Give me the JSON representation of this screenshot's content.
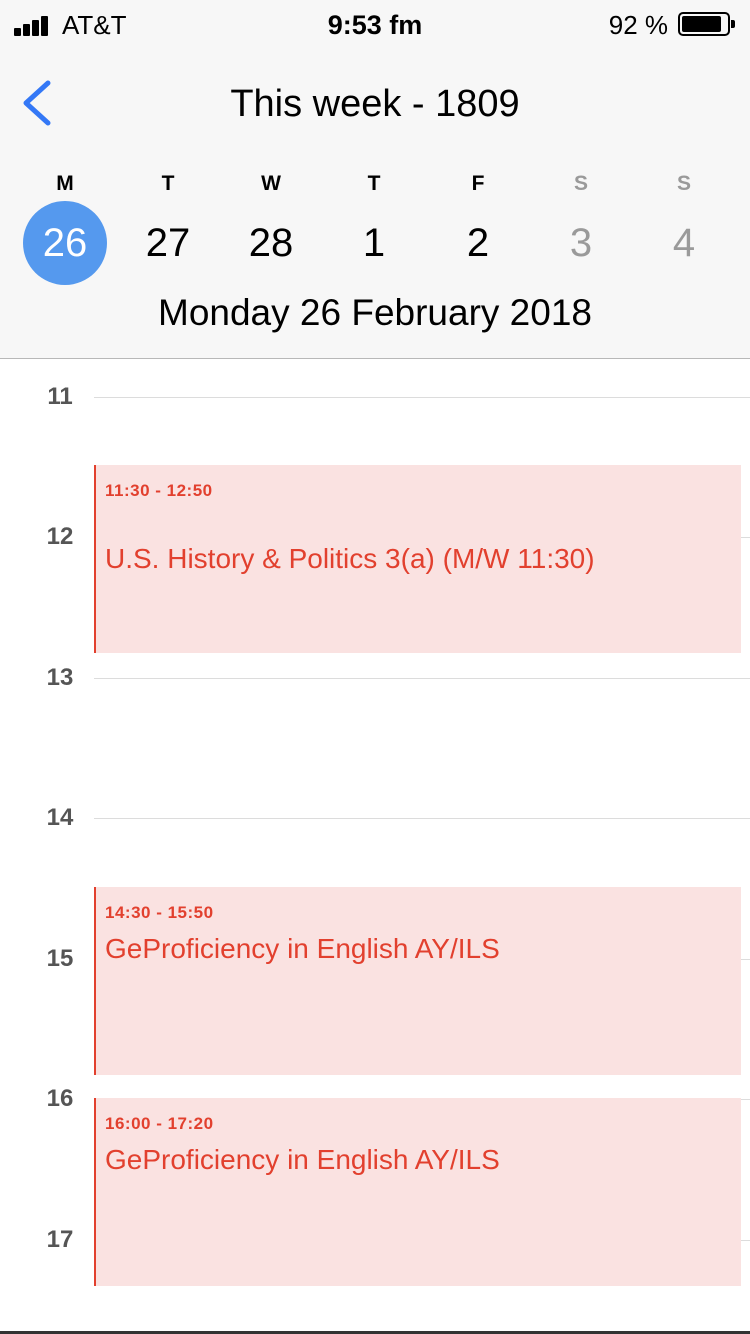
{
  "status_bar": {
    "carrier": "AT&T",
    "time": "9:53 fm",
    "battery_percent": "92 %",
    "battery_level": 0.92
  },
  "nav": {
    "back_icon": "chevron-left-icon",
    "title": "This week - 1809"
  },
  "week": {
    "days": [
      {
        "letter": "M",
        "number": "26",
        "selected": true,
        "weekend": false
      },
      {
        "letter": "T",
        "number": "27",
        "selected": false,
        "weekend": false
      },
      {
        "letter": "W",
        "number": "28",
        "selected": false,
        "weekend": false
      },
      {
        "letter": "T",
        "number": "1",
        "selected": false,
        "weekend": false
      },
      {
        "letter": "F",
        "number": "2",
        "selected": false,
        "weekend": false
      },
      {
        "letter": "S",
        "number": "3",
        "selected": false,
        "weekend": true
      },
      {
        "letter": "S",
        "number": "4",
        "selected": false,
        "weekend": true
      }
    ],
    "selected_date_label": "Monday 26 February 2018"
  },
  "timeline": {
    "hours": [
      "11",
      "12",
      "13",
      "14",
      "15",
      "16",
      "17"
    ],
    "events": [
      {
        "time": "11:30 - 12:50",
        "title": "U.S. History & Politics 3(a) (M/W 11:30)"
      },
      {
        "time": "14:30 - 15:50",
        "title": "GeProficiency in English AY/ILS"
      },
      {
        "time": "16:00 - 17:20",
        "title": "GeProficiency in English AY/ILS"
      }
    ]
  },
  "colors": {
    "accent": "#5599ee",
    "event_text": "#e2402e",
    "event_background": "#fae2e1"
  }
}
